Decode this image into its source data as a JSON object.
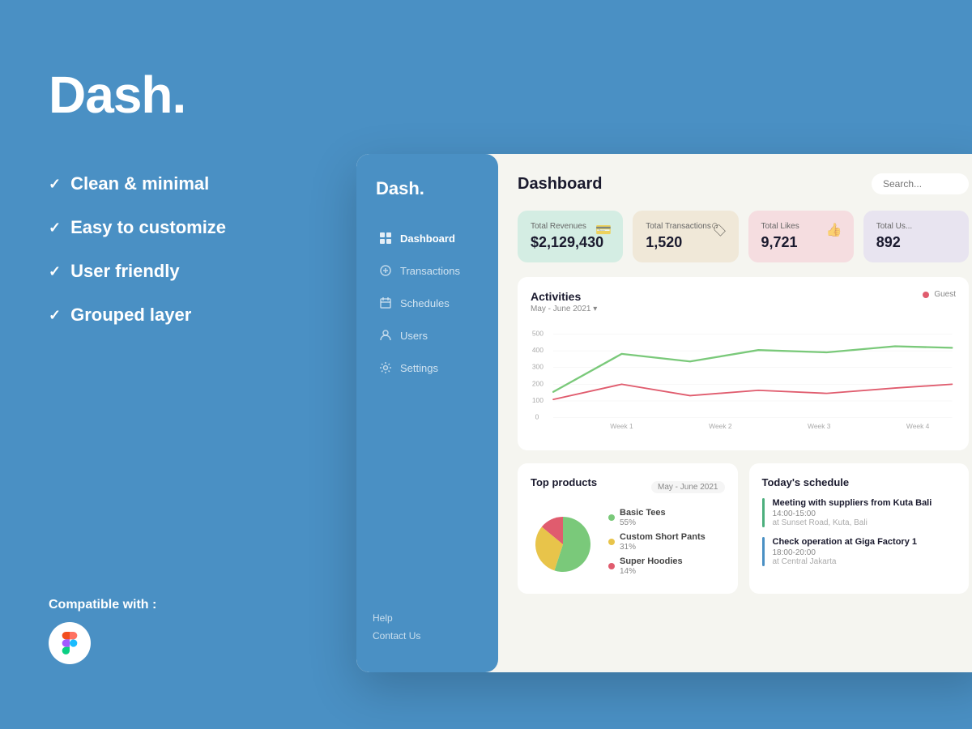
{
  "left": {
    "brand": "Dash.",
    "features": [
      "Clean & minimal",
      "Easy to customize",
      "User friendly",
      "Grouped layer"
    ],
    "compatible_label": "Compatible with :"
  },
  "sidebar": {
    "brand": "Dash.",
    "nav_items": [
      {
        "label": "Dashboard",
        "active": true,
        "icon": "dashboard"
      },
      {
        "label": "Transactions",
        "active": false,
        "icon": "transactions"
      },
      {
        "label": "Schedules",
        "active": false,
        "icon": "schedules"
      },
      {
        "label": "Users",
        "active": false,
        "icon": "users"
      },
      {
        "label": "Settings",
        "active": false,
        "icon": "settings"
      }
    ],
    "footer": [
      {
        "label": "Help"
      },
      {
        "label": "Contact Us"
      }
    ]
  },
  "header": {
    "title": "Dashboard",
    "search_placeholder": "Search..."
  },
  "stats": [
    {
      "label": "Total Revenues",
      "value": "$2,129,430",
      "icon": "💳",
      "color": "green"
    },
    {
      "label": "Total Transactions",
      "value": "1,520",
      "icon": "🏷",
      "color": "beige"
    },
    {
      "label": "Total Likes",
      "value": "9,721",
      "icon": "👍",
      "color": "pink"
    },
    {
      "label": "Total Us...",
      "value": "892",
      "icon": "",
      "color": "purple"
    }
  ],
  "activities_chart": {
    "title": "Activities",
    "subtitle": "May - June 2021",
    "legend": [
      {
        "label": "Guest",
        "color": "#e05c6e"
      }
    ],
    "y_labels": [
      "500",
      "400",
      "300",
      "200",
      "100",
      "0"
    ],
    "x_labels": [
      "Week 1",
      "Week 2",
      "Week 3",
      "Week 4"
    ]
  },
  "top_products": {
    "title": "Top products",
    "filter": "May - June 2021",
    "items": [
      {
        "name": "Basic Tees",
        "pct": "55%",
        "color": "#7ac97a"
      },
      {
        "name": "Custom Short Pants",
        "pct": "31%",
        "color": "#e8c44a"
      },
      {
        "name": "Super Hoodies",
        "pct": "14%",
        "color": "#e05c6e"
      }
    ]
  },
  "schedule": {
    "title": "Today's schedule",
    "items": [
      {
        "name": "Meeting with suppliers from Kuta Bali",
        "time": "14:00-15:00",
        "location": "at Sunset Road, Kuta, Bali",
        "color": "green"
      },
      {
        "name": "Check operation at Giga Factory 1",
        "time": "18:00-20:00",
        "location": "at Central Jakarta",
        "color": "blue"
      }
    ]
  }
}
